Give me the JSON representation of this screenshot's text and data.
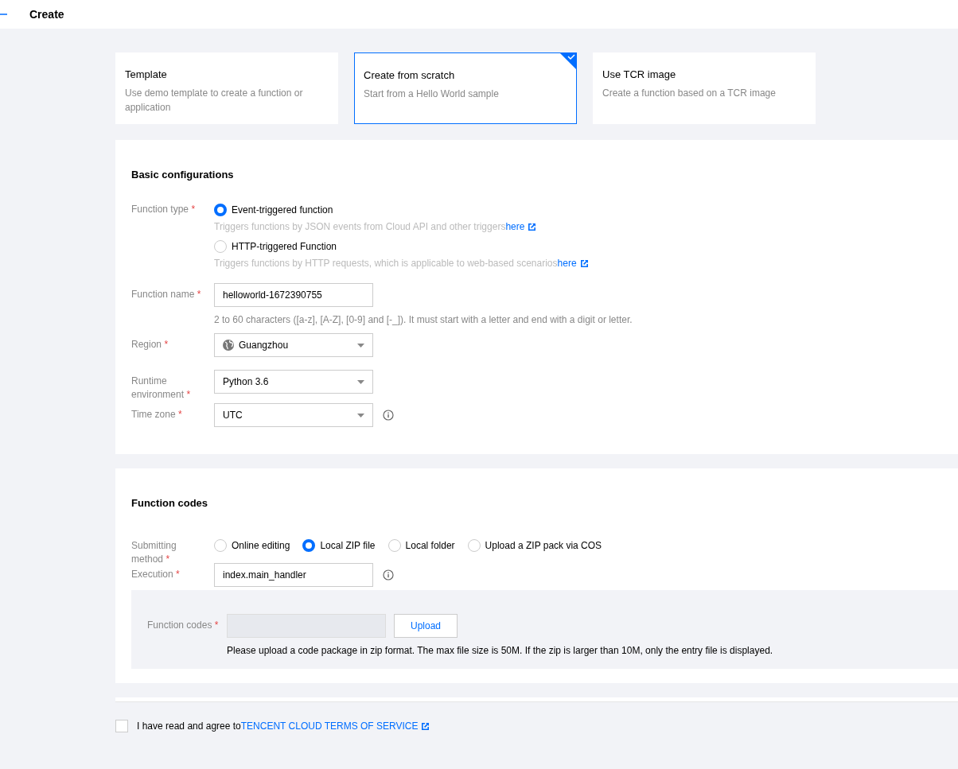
{
  "header": {
    "title": "Create"
  },
  "creation_methods": [
    {
      "title": "Template",
      "description": "Use demo template to create a function or application",
      "selected": false
    },
    {
      "title": "Create from scratch",
      "description": "Start from a Hello World sample",
      "selected": true
    },
    {
      "title": "Use TCR image",
      "description": "Create a function based on a TCR image",
      "selected": false
    }
  ],
  "basic_configurations": {
    "title": "Basic configurations",
    "function_type": {
      "label": "Function type",
      "asterisk": "*",
      "options": [
        {
          "label": "Event-triggered function",
          "hint": "Triggers functions by JSON events from Cloud API and other triggers",
          "link": "here",
          "selected": true
        },
        {
          "label": "HTTP-triggered Function",
          "hint": "Triggers functions by HTTP requests, which is applicable to web-based scenarios",
          "link": "here",
          "selected": false
        }
      ]
    },
    "function_name": {
      "label": "Function name",
      "asterisk": "*",
      "value": "helloworld-1672390755",
      "hint": "2 to 60 characters ([a-z], [A-Z], [0-9] and [-_]). It must start with a letter and end with a digit or letter."
    },
    "selects": [
      {
        "label": "Region",
        "asterisk": "*",
        "value": "Guangzhou",
        "kind": "globe"
      },
      {
        "label": "Runtime environment",
        "asterisk": "*",
        "value": "Python 3.6",
        "kind": "plain"
      },
      {
        "label": "Time zone",
        "asterisk": "*",
        "value": "UTC",
        "kind": "info"
      }
    ]
  },
  "function_codes": {
    "title": "Function codes",
    "submitting_method": {
      "label": "Submitting method",
      "asterisk": "*",
      "options": [
        {
          "label": "Online editing",
          "selected": false
        },
        {
          "label": "Local ZIP file",
          "selected": true
        },
        {
          "label": "Local folder",
          "selected": false
        },
        {
          "label": "Upload a ZIP pack via COS",
          "selected": false
        }
      ]
    },
    "execution": {
      "label": "Execution",
      "asterisk": "*",
      "value": "index.main_handler"
    },
    "upload": {
      "label": "Function codes",
      "asterisk": "*",
      "button": "Upload",
      "note": "Please upload a code package in zip format. The max file size is 50M. If the zip is larger than 10M, only the entry file is displayed."
    }
  },
  "agreement": {
    "checked": false,
    "text": "I have read and agree to",
    "link": "TENCENT CLOUD TERMS OF SERVICE"
  }
}
